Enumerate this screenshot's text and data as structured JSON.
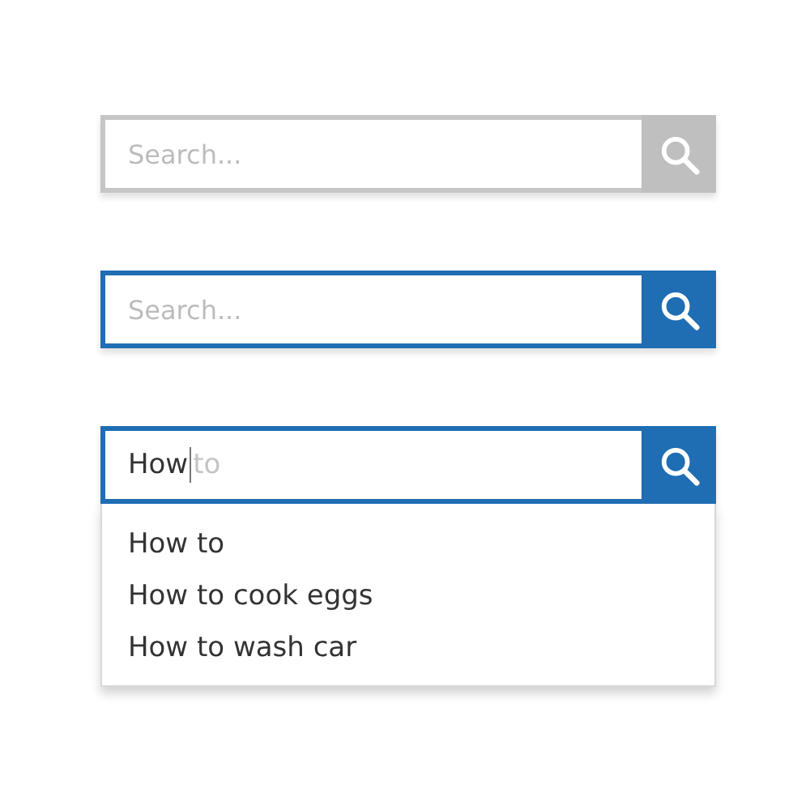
{
  "search_bars": [
    {
      "placeholder": "Search...",
      "focused": false
    },
    {
      "placeholder": "Search...",
      "focused": true
    },
    {
      "value": "How",
      "completion": "to",
      "focused": true,
      "suggestions": [
        "How to",
        "How to cook eggs",
        "How to wash car"
      ]
    }
  ]
}
